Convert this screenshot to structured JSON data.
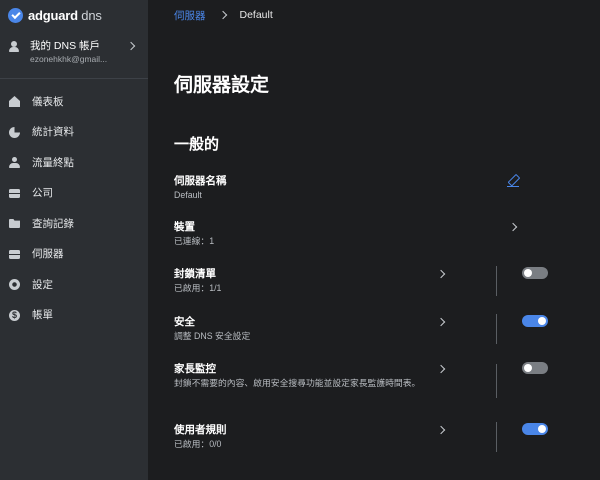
{
  "logo": {
    "brand": "adguard",
    "product": " dns"
  },
  "account": {
    "name": "我的 DNS 帳戶",
    "email": "ezonehkhk@gmail..."
  },
  "nav": {
    "items": [
      {
        "label": "儀表板",
        "icon": "home-icon"
      },
      {
        "label": "統計資料",
        "icon": "pie-chart-icon"
      },
      {
        "label": "流量終點",
        "icon": "user-icon"
      },
      {
        "label": "公司",
        "icon": "briefcase-icon"
      },
      {
        "label": "查詢記錄",
        "icon": "folder-icon"
      },
      {
        "label": "伺服器",
        "icon": "server-icon"
      },
      {
        "label": "設定",
        "icon": "gear-icon"
      },
      {
        "label": "帳單",
        "icon": "dollar-icon"
      }
    ]
  },
  "breadcrumb": {
    "parent": "伺服器",
    "current": "Default"
  },
  "page": {
    "title": "伺服器設定",
    "section": "一般的"
  },
  "settings": {
    "server_name": {
      "title": "伺服器名稱",
      "sub": "Default"
    },
    "devices": {
      "title": "裝置",
      "sub": "已連線：1"
    },
    "blocklists": {
      "title": "封鎖清單",
      "sub": "已啟用：1/1",
      "enabled": false
    },
    "security": {
      "title": "安全",
      "sub": "調整 DNS 安全設定",
      "enabled": true
    },
    "parental": {
      "title": "家長監控",
      "sub": "封鎖不需要的內容、啟用安全搜尋功能並設定家長監護時間表。",
      "enabled": false
    },
    "user_rules": {
      "title": "使用者規則",
      "sub": "已啟用：0/0",
      "enabled": true
    }
  },
  "colors": {
    "accent": "#4a86e8",
    "sidebar": "#2c2f33",
    "background": "#1c1d1f"
  }
}
